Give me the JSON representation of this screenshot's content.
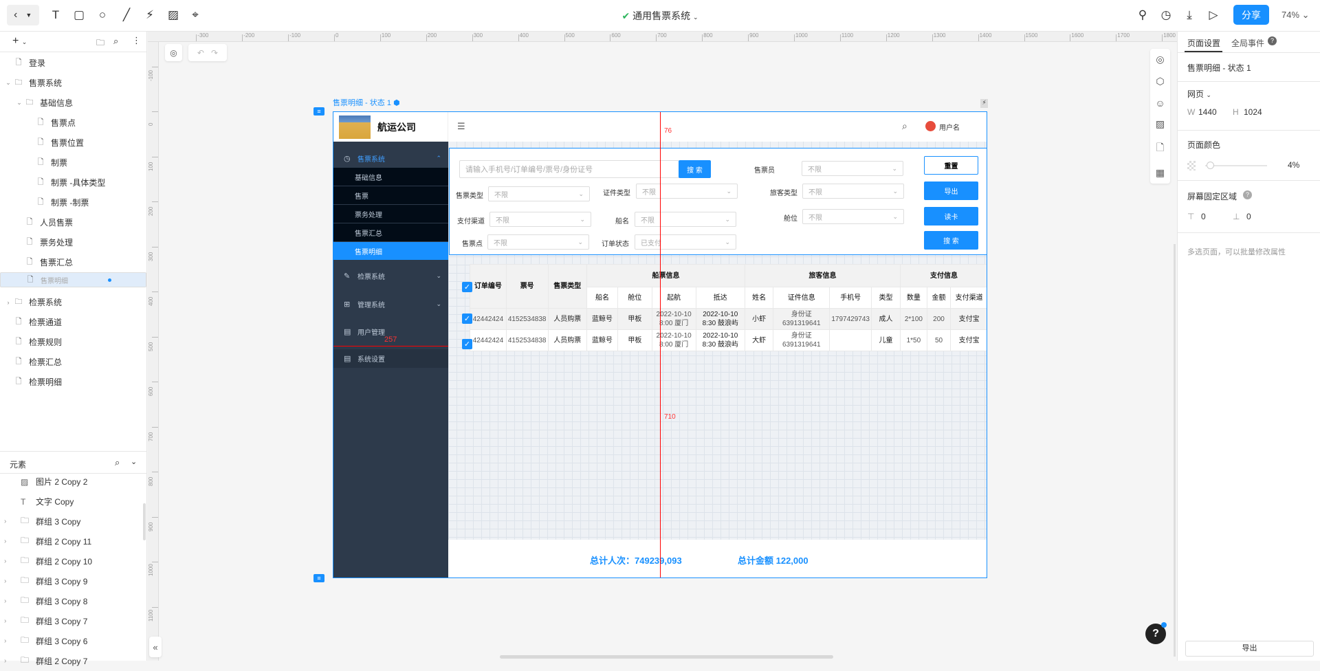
{
  "toolbar": {
    "title": "通用售票系统",
    "share": "分享",
    "zoom": "74%",
    "tools": [
      "text-tool-icon",
      "rectangle-tool-icon",
      "circle-tool-icon",
      "line-tool-icon",
      "hotspot-tool-icon",
      "image-tool-icon",
      "location-tool-icon"
    ]
  },
  "left_panel": {
    "pages": [
      {
        "label": "登录",
        "type": "page",
        "depth": 0
      },
      {
        "label": "售票系统",
        "type": "folder",
        "depth": 0,
        "expanded": true
      },
      {
        "label": "基础信息",
        "type": "folder",
        "depth": 1,
        "expanded": true
      },
      {
        "label": "售票点",
        "type": "page",
        "depth": 2
      },
      {
        "label": "售票位置",
        "type": "page",
        "depth": 2
      },
      {
        "label": "制票",
        "type": "page",
        "depth": 2
      },
      {
        "label": "制票 -具体类型",
        "type": "page",
        "depth": 2
      },
      {
        "label": "制票 -制票",
        "type": "page",
        "depth": 2
      },
      {
        "label": "人员售票",
        "type": "page",
        "depth": 1
      },
      {
        "label": "票务处理",
        "type": "page",
        "depth": 1
      },
      {
        "label": "售票汇总",
        "type": "page",
        "depth": 1
      },
      {
        "label": "售票明细",
        "type": "page",
        "depth": 1,
        "selected": true
      },
      {
        "label": "检票系统",
        "type": "folder",
        "depth": 0,
        "expanded": false
      },
      {
        "label": "检票通道",
        "type": "page",
        "depth": 0
      },
      {
        "label": "检票规则",
        "type": "page",
        "depth": 0
      },
      {
        "label": "检票汇总",
        "type": "page",
        "depth": 0
      },
      {
        "label": "检票明细",
        "type": "page",
        "depth": 0
      }
    ],
    "elements_title": "元素",
    "elements": [
      {
        "label": "图片 2 Copy 2",
        "type": "image"
      },
      {
        "label": "文字 Copy",
        "type": "text"
      },
      {
        "label": "群组 3 Copy",
        "type": "group"
      },
      {
        "label": "群组 2 Copy 11",
        "type": "group"
      },
      {
        "label": "群组 2 Copy 10",
        "type": "group"
      },
      {
        "label": "群组 3 Copy 9",
        "type": "group"
      },
      {
        "label": "群组 3 Copy 8",
        "type": "group"
      },
      {
        "label": "群组 3 Copy 7",
        "type": "group"
      },
      {
        "label": "群组 3 Copy 6",
        "type": "group"
      },
      {
        "label": "群组 2 Copy 7",
        "type": "group"
      }
    ]
  },
  "rulers": {
    "h": [
      "-300",
      "-200",
      "-100",
      "0",
      "100",
      "200",
      "300",
      "400",
      "500",
      "600",
      "700",
      "800",
      "900",
      "1000",
      "1100",
      "1200",
      "1300",
      "1400",
      "1500",
      "1600",
      "1700",
      "1800"
    ],
    "v": [
      "-100",
      "0",
      "100",
      "200",
      "300",
      "400",
      "500",
      "600",
      "700",
      "800",
      "900",
      "1000",
      "1100"
    ]
  },
  "artboard": {
    "label": "售票明细 - 状态 1",
    "measure_top": "76",
    "measure_bottom": "710",
    "measure_left": "257",
    "company": "航运公司",
    "username": "用户名",
    "nav": {
      "main1": "售票系统",
      "subs": [
        "基础信息",
        "售票",
        "票务处理",
        "售票汇总",
        "售票明细"
      ],
      "active_sub": 4,
      "main2": "检票系统",
      "main3": "管理系统",
      "main4": "用户管理",
      "main5": "系统设置"
    },
    "form": {
      "search_placeholder": "请输入手机号/订单编号/票号/身份证号",
      "search_btn": "搜 索",
      "fields": [
        {
          "label": "售票员",
          "value": "不限"
        },
        {
          "label": "售票类型",
          "value": "不限"
        },
        {
          "label": "证件类型",
          "value": "不限"
        },
        {
          "label": "旅客类型",
          "value": "不限"
        },
        {
          "label": "支付渠道",
          "value": "不限"
        },
        {
          "label": "船名",
          "value": "不限"
        },
        {
          "label": "舱位",
          "value": "不限"
        },
        {
          "label": "售票点",
          "value": "不限"
        },
        {
          "label": "订单状态",
          "value": "已支付"
        }
      ],
      "buttons": {
        "reset": "重置",
        "export": "导出",
        "read_card": "读卡",
        "search": "搜 索"
      }
    },
    "table": {
      "groups": {
        "ticket": "船票信息",
        "passenger": "旅客信息",
        "payment": "支付信息"
      },
      "headers": [
        "订单编号",
        "票号",
        "售票类型",
        "船名",
        "舱位",
        "起航",
        "抵达",
        "姓名",
        "证件信息",
        "手机号",
        "类型",
        "数量",
        "金额",
        "支付渠道"
      ],
      "rows": [
        [
          "42442424",
          "4152534838",
          "人员购票",
          "蓝鲸号",
          "甲板",
          "2022-10-10 8:00 厦门",
          "2022-10-10 8:30 鼓浪屿",
          "小虾",
          "身份证 6391319641",
          "1797429743",
          "成人",
          "2*100",
          "200",
          "支付宝"
        ],
        [
          "42442424",
          "4152534838",
          "人员购票",
          "蓝鲸号",
          "甲板",
          "2022-10-10 8:00 厦门",
          "2022-10-10 8:30 鼓浪屿",
          "大虾",
          "身份证 6391319641",
          "",
          "儿童",
          "1*50",
          "50",
          "支付宝"
        ]
      ]
    },
    "totals": {
      "people": "总计人次：749239,093",
      "amount": "总计金额  122,000"
    }
  },
  "right_panel": {
    "tabs": [
      "页面设置",
      "全局事件"
    ],
    "page_name": "售票明细 - 状态 1",
    "page_type": "网页",
    "w_label": "W",
    "w": "1440",
    "h_label": "H",
    "h": "1024",
    "color_title": "页面颜色",
    "opacity": "4%",
    "fixed_title": "屏幕固定区域",
    "fixed_top": "0",
    "fixed_bottom": "0",
    "multi_hint": "多选页面，可以批量修改属性",
    "export": "导出"
  },
  "colors": {
    "accent": "#1890ff",
    "sidebar": "#2d3a4b",
    "submenu": "#020c17",
    "guide": "#ff0000"
  }
}
